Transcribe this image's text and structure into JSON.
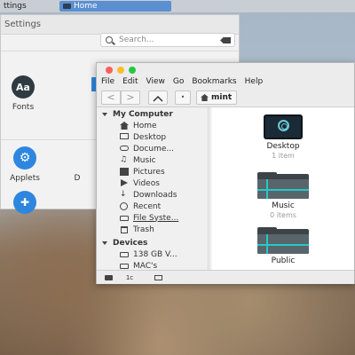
{
  "taskbar": {
    "settings_label": "ttings",
    "home_label": "Home"
  },
  "settings": {
    "title": "Settings",
    "search_placeholder": "Search...",
    "items": [
      {
        "label": "Fonts",
        "glyph": "Aa",
        "color": "#2f3b43"
      },
      {
        "label": "Applets",
        "glyph": "⚙",
        "color": "#2e86de"
      },
      {
        "label": "D",
        "glyph": "",
        "color": ""
      },
      {
        "label": "",
        "glyph": "✚",
        "color": "#2e86de"
      }
    ]
  },
  "file_manager": {
    "menu": [
      "File",
      "Edit",
      "View",
      "Go",
      "Bookmarks",
      "Help"
    ],
    "nav": {
      "back": "<",
      "forward": ">",
      "up": "^",
      "toggle": "•"
    },
    "breadcrumb": "mint",
    "sidebar": {
      "sections": [
        {
          "title": "My Computer",
          "items": [
            {
              "label": "Home",
              "icon": "home-icon"
            },
            {
              "label": "Desktop",
              "icon": "desktop-icon"
            },
            {
              "label": "Docume...",
              "icon": "documents-icon"
            },
            {
              "label": "Music",
              "icon": "music-icon"
            },
            {
              "label": "Pictures",
              "icon": "pictures-icon"
            },
            {
              "label": "Videos",
              "icon": "videos-icon"
            },
            {
              "label": "Downloads",
              "icon": "downloads-icon"
            },
            {
              "label": "Recent",
              "icon": "recent-icon"
            },
            {
              "label": "File Syste...",
              "icon": "drive-icon"
            },
            {
              "label": "Trash",
              "icon": "trash-icon"
            }
          ]
        },
        {
          "title": "Devices",
          "items": [
            {
              "label": "138 GB V...",
              "icon": "drive-icon"
            },
            {
              "label": "MAC's",
              "icon": "drive-icon"
            }
          ]
        }
      ]
    },
    "files": [
      {
        "name": "Desktop",
        "sub": "1 item",
        "icon": "desktop-folder-icon"
      },
      {
        "name": "Music",
        "sub": "0 items",
        "icon": "music-folder-icon"
      },
      {
        "name": "Public",
        "sub": "",
        "icon": "public-folder-icon"
      }
    ],
    "statusbar": {
      "b2": "1c"
    }
  }
}
